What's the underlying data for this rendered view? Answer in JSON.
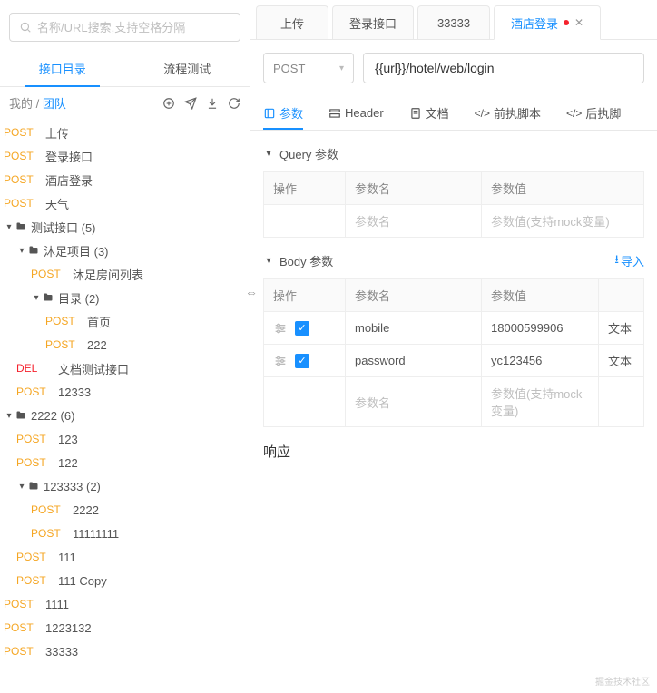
{
  "search": {
    "placeholder": "名称/URL搜索,支持空格分隔"
  },
  "side_tabs": {
    "api_dir": "接口目录",
    "flow_test": "流程测试"
  },
  "breadcrumb": {
    "mine": "我的",
    "sep": "/",
    "team": "团队"
  },
  "tree": [
    {
      "depth": 0,
      "method": "POST",
      "label": "上传"
    },
    {
      "depth": 0,
      "method": "POST",
      "label": "登录接口"
    },
    {
      "depth": 0,
      "method": "POST",
      "label": "酒店登录"
    },
    {
      "depth": 0,
      "method": "POST",
      "label": "天气"
    },
    {
      "depth": 0,
      "folder": true,
      "caret": "▾",
      "label": "测试接口 (5)"
    },
    {
      "depth": 1,
      "folder": true,
      "caret": "▾",
      "label": "沐足项目 (3)"
    },
    {
      "depth": 2,
      "method": "POST",
      "label": "沐足房间列表"
    },
    {
      "depth": 2,
      "folder": true,
      "caret": "▾",
      "label": "目录 (2)"
    },
    {
      "depth": 3,
      "method": "POST",
      "label": "首页"
    },
    {
      "depth": 3,
      "method": "POST",
      "label": "222"
    },
    {
      "depth": 1,
      "method": "DEL",
      "label": "文档测试接口"
    },
    {
      "depth": 1,
      "method": "POST",
      "label": "12333"
    },
    {
      "depth": 0,
      "folder": true,
      "caret": "▾",
      "label": "2222 (6)"
    },
    {
      "depth": 1,
      "method": "POST",
      "label": "123"
    },
    {
      "depth": 1,
      "method": "POST",
      "label": "122"
    },
    {
      "depth": 1,
      "folder": true,
      "caret": "▾",
      "label": "123333 (2)"
    },
    {
      "depth": 2,
      "method": "POST",
      "label": "2222"
    },
    {
      "depth": 2,
      "method": "POST",
      "label": "11111111"
    },
    {
      "depth": 1,
      "method": "POST",
      "label": "111"
    },
    {
      "depth": 1,
      "method": "POST",
      "label": "111 Copy"
    },
    {
      "depth": 0,
      "method": "POST",
      "label": "1111"
    },
    {
      "depth": 0,
      "method": "POST",
      "label": "1223132"
    },
    {
      "depth": 0,
      "method": "POST",
      "label": "33333"
    }
  ],
  "top_tabs": [
    {
      "label": "上传",
      "active": false
    },
    {
      "label": "登录接口",
      "active": false
    },
    {
      "label": "33333",
      "active": false
    },
    {
      "label": "酒店登录",
      "active": true,
      "dirty": true
    }
  ],
  "request": {
    "method": "POST",
    "url": "{{url}}/hotel/web/login"
  },
  "sub_tabs": {
    "params": "参数",
    "header": "Header",
    "doc": "文档",
    "pre": "前执脚本",
    "post": "后执脚"
  },
  "query": {
    "title": "Query 参数",
    "cols": {
      "ops": "操作",
      "name": "参数名",
      "value": "参数值"
    },
    "placeholder_name": "参数名",
    "placeholder_value": "参数值(支持mock变量)"
  },
  "body": {
    "title": "Body 参数",
    "import": "导入",
    "cols": {
      "ops": "操作",
      "name": "参数名",
      "value": "参数值",
      "type": ""
    },
    "type_label": "文本",
    "rows": [
      {
        "name": "mobile",
        "value": "18000599906"
      },
      {
        "name": "password",
        "value": "yc123456"
      }
    ],
    "placeholder_name": "参数名",
    "placeholder_value": "参数值(支持mock变量)"
  },
  "response": {
    "title": "响应"
  },
  "watermark": "掘金技术社区"
}
